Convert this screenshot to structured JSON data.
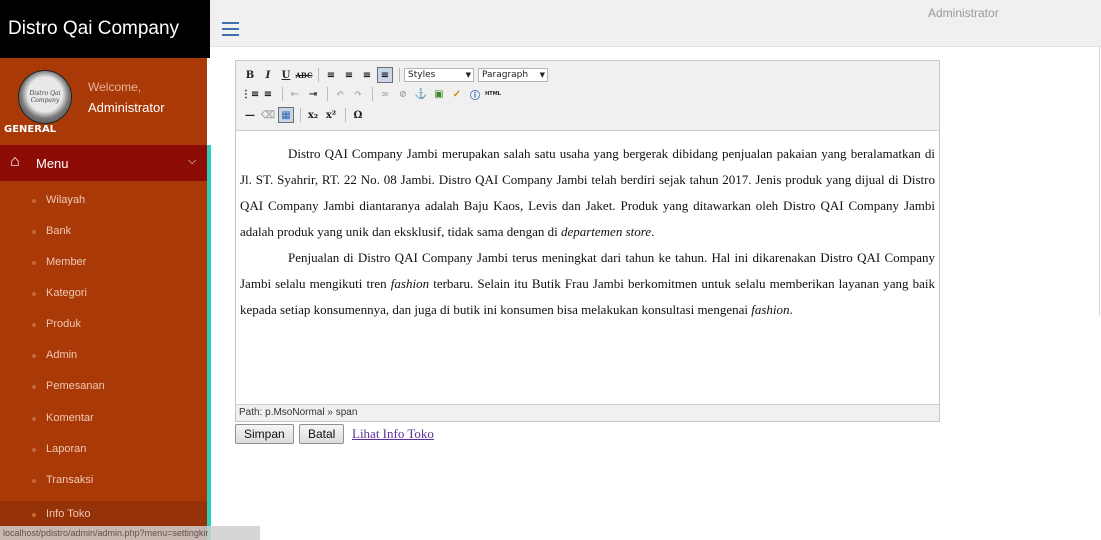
{
  "brand": "Distro Qai Company",
  "profile": {
    "avatar_text": "Distro Qai Company",
    "welcome": "Welcome,",
    "name": "Administrator",
    "section": "GENERAL"
  },
  "menu": {
    "label": "Menu",
    "items": [
      "Wilayah",
      "Bank",
      "Member",
      "Kategori",
      "Produk",
      "Admin",
      "Pemesanan",
      "Komentar",
      "Laporan",
      "Transaksi",
      "Info Toko"
    ]
  },
  "topbar": {
    "user": "Administrator"
  },
  "editor": {
    "styles_select": "Styles",
    "format_select": "Paragraph",
    "html_label": "HTML",
    "p1_a": "Distro QAI Company Jambi merupakan salah satu usaha yang bergerak dibidang penjualan pakaian yang beralamatkan di Jl. ST. Syahrir, RT. 22 No. 08 Jambi. Distro QAI Company Jambi telah berdiri sejak tahun 2017. Jenis produk yang dijual di Distro QAI Company Jambi diantaranya adalah Baju Kaos, Levis dan Jaket. Produk yang ditawarkan oleh Distro QAI Company Jambi adalah produk yang unik dan eksklusif, tidak sama dengan di ",
    "p1_em": "departemen store",
    "p1_end": ".",
    "p2_a": "Penjualan di Distro QAI Company Jambi terus meningkat dari tahun ke tahun. Hal ini dikarenakan Distro QAI Company Jambi selalu mengikuti tren ",
    "p2_em1": "fashion",
    "p2_b": " terbaru. Selain itu Butik Frau Jambi berkomitmen untuk selalu memberikan layanan yang baik kepada setiap konsumennya, dan juga di butik ini konsumen bisa melakukan konsultasi mengenai ",
    "p2_em2": "fashion",
    "p2_end": ".",
    "path": "Path: p.MsoNormal » span"
  },
  "actions": {
    "save": "Simpan",
    "cancel": "Batal",
    "link": "Lihat Info Toko"
  },
  "status_url": "localhost/pdistro/admin/admin.php?menu=settingkir",
  "colors": {
    "sidebar": "#a93a07",
    "menu_header": "#8e0c06",
    "accent": "#2ccfbb",
    "brand_bg": "#000000"
  }
}
